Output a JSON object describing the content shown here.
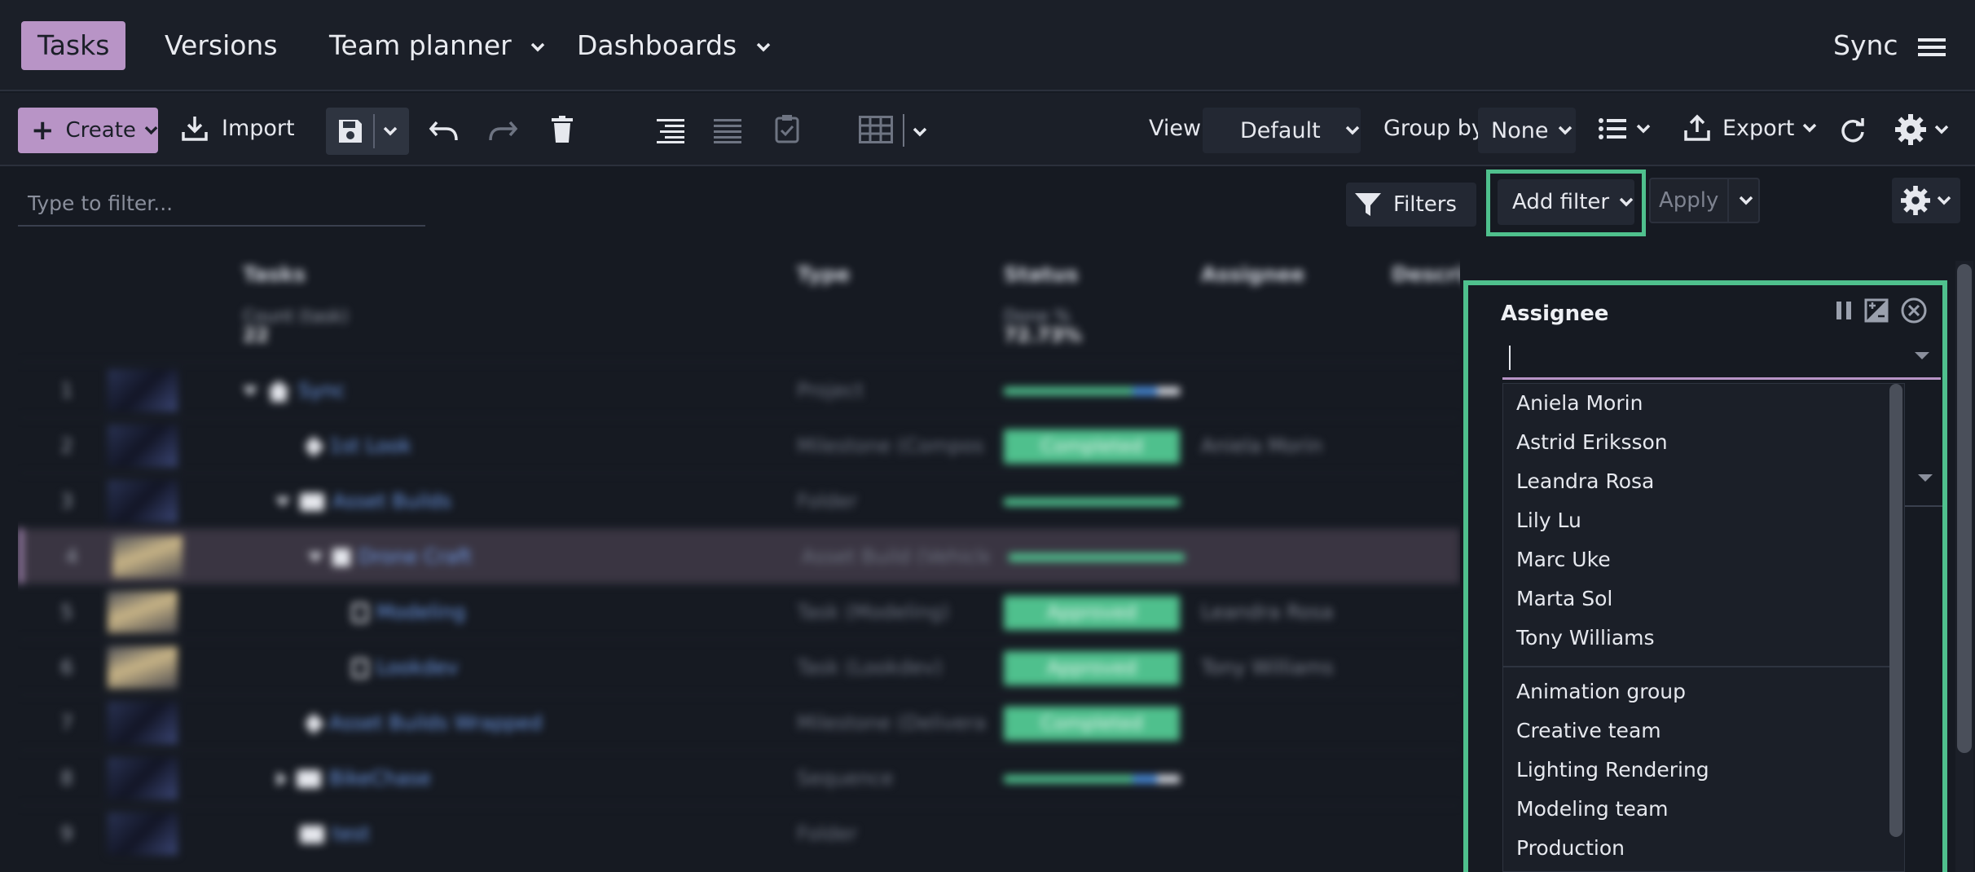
{
  "nav": {
    "tabs": [
      {
        "label": "Tasks",
        "active": true
      },
      {
        "label": "Versions"
      },
      {
        "label": "Team planner",
        "dropdown": true
      },
      {
        "label": "Dashboards",
        "dropdown": true
      }
    ],
    "project": "Sync"
  },
  "toolbar": {
    "create_label": "Create",
    "import_label": "Import",
    "view_label": "View",
    "view_value": "Default",
    "groupby_label": "Group by",
    "groupby_value": "None",
    "export_label": "Export"
  },
  "filterbar": {
    "placeholder": "Type to filter...",
    "filters_label": "Filters",
    "add_filter_label": "Add filter",
    "apply_label": "Apply"
  },
  "table": {
    "headers": {
      "tasks": "Tasks",
      "type": "Type",
      "status": "Status",
      "assignee": "Assignee",
      "description": "Descrip"
    },
    "summary": {
      "count_label": "Count (task)",
      "count_value": "22",
      "done_label": "Done %",
      "done_value": "72.73%"
    },
    "rows": [
      {
        "num": "1",
        "name": "Sync",
        "type": "Project",
        "status": "",
        "assignee": ""
      },
      {
        "num": "2",
        "name": "1st Look",
        "type": "Milestone (Compos...",
        "status": "Completed",
        "assignee": "Aniela Morin"
      },
      {
        "num": "3",
        "name": "Asset Builds",
        "type": "Folder",
        "status": "",
        "assignee": ""
      },
      {
        "num": "4",
        "name": "Drone Craft",
        "type": "Asset Build (Vehicle)",
        "status": "",
        "assignee": ""
      },
      {
        "num": "5",
        "name": "Modeling",
        "type": "Task (Modeling)",
        "status": "Approved",
        "assignee": "Leandra Rosa"
      },
      {
        "num": "6",
        "name": "Lookdev",
        "type": "Task (Lookdev)",
        "status": "Approved",
        "assignee": "Tony Williams"
      },
      {
        "num": "7",
        "name": "Asset Builds Wrapped",
        "type": "Milestone (Delivera...",
        "status": "Completed",
        "assignee": ""
      },
      {
        "num": "8",
        "name": "BikeChase",
        "type": "Sequence",
        "status": "",
        "assignee": ""
      },
      {
        "num": "9",
        "name": "test",
        "type": "Folder",
        "status": "",
        "assignee": ""
      }
    ]
  },
  "assignee_panel": {
    "title": "Assignee",
    "users": [
      "Aniela Morin",
      "Astrid Eriksson",
      "Leandra Rosa",
      "Lily Lu",
      "Marc Uke",
      "Marta Sol",
      "Tony Williams"
    ],
    "groups": [
      "Animation group",
      "Creative team",
      "Lighting Rendering",
      "Modeling team",
      "Production"
    ]
  },
  "colors": {
    "accent": "#b894c6",
    "highlight": "#4fc08d",
    "link": "#6f9be8",
    "background": "#161a22"
  }
}
